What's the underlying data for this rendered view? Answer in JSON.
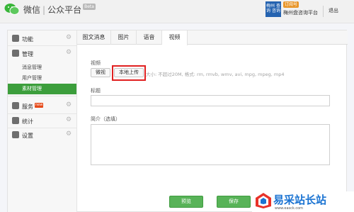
{
  "header": {
    "brand_name": "微信",
    "brand_separator": "|",
    "product_name": "公众平台",
    "beta_badge": "Beta",
    "account_avatar_text": "梅州 查询 咨询",
    "account_type_badge": "订阅号",
    "account_name": "梅州盘咨询平台",
    "logout_label": "退出"
  },
  "sidebar": {
    "sections": [
      {
        "label": "功能",
        "icon": "grid-icon"
      },
      {
        "label": "管理",
        "icon": "folder-icon",
        "items": [
          "消息管理",
          "用户管理",
          "素材管理"
        ],
        "active_item": "素材管理"
      },
      {
        "label": "服务",
        "icon": "service-icon",
        "badge": "new"
      },
      {
        "label": "统计",
        "icon": "stats-icon"
      },
      {
        "label": "设置",
        "icon": "settings-icon"
      }
    ]
  },
  "tabs": [
    {
      "label": "图文消息"
    },
    {
      "label": "图片"
    },
    {
      "label": "语音"
    },
    {
      "label": "视频",
      "active": true
    }
  ],
  "form": {
    "video_label": "视频",
    "local_video_button": "微视",
    "upload_button": "本地上传",
    "upload_hint": "大小: 不超过20M,  格式: rm, rmvb, wmv, avi, mpg, mpeg, mp4",
    "title_label": "标题",
    "title_value": "",
    "summary_label": "简介（选填）",
    "summary_value": ""
  },
  "actions": {
    "preview_label": "预览",
    "save_label": "保存"
  },
  "watermark": {
    "title": "易采站长站",
    "url": "www.easck.com"
  },
  "colors": {
    "accent_green": "#3c9e3c",
    "highlight_red": "#e02020",
    "watermark_blue": "#1a73d2"
  }
}
